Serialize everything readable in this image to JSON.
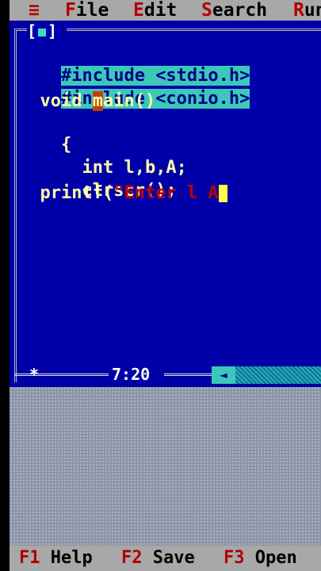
{
  "menu": {
    "system_icon": "≡",
    "items": [
      "File",
      "Edit",
      "Search",
      "Run"
    ]
  },
  "editor": {
    "close_box": "[",
    "close_box_end": "]",
    "code": {
      "line1": "#include <stdio.h>",
      "line2": "#include <conio.h>",
      "line3_pre": "  void ",
      "line3_cursor": "m",
      "line3_post": "ain()",
      "line4": "{",
      "line5": "  int l,b,A;",
      "line6": "  clrscr();",
      "line7_pre": "  printf(",
      "line7_str": "\"Enter l A"
    },
    "status": {
      "star": "*",
      "position": "7:20",
      "scroll_arrow": "◄"
    }
  },
  "fkeys": [
    {
      "key": "F1",
      "label": "Help"
    },
    {
      "key": "F2",
      "label": "Save"
    },
    {
      "key": "F3",
      "label": "Open"
    }
  ],
  "colors": {
    "editor_bg": "#0000a8",
    "selection": "#3cc8b8",
    "menu_bg": "#a8a8a8",
    "hotkey": "#b00000"
  }
}
